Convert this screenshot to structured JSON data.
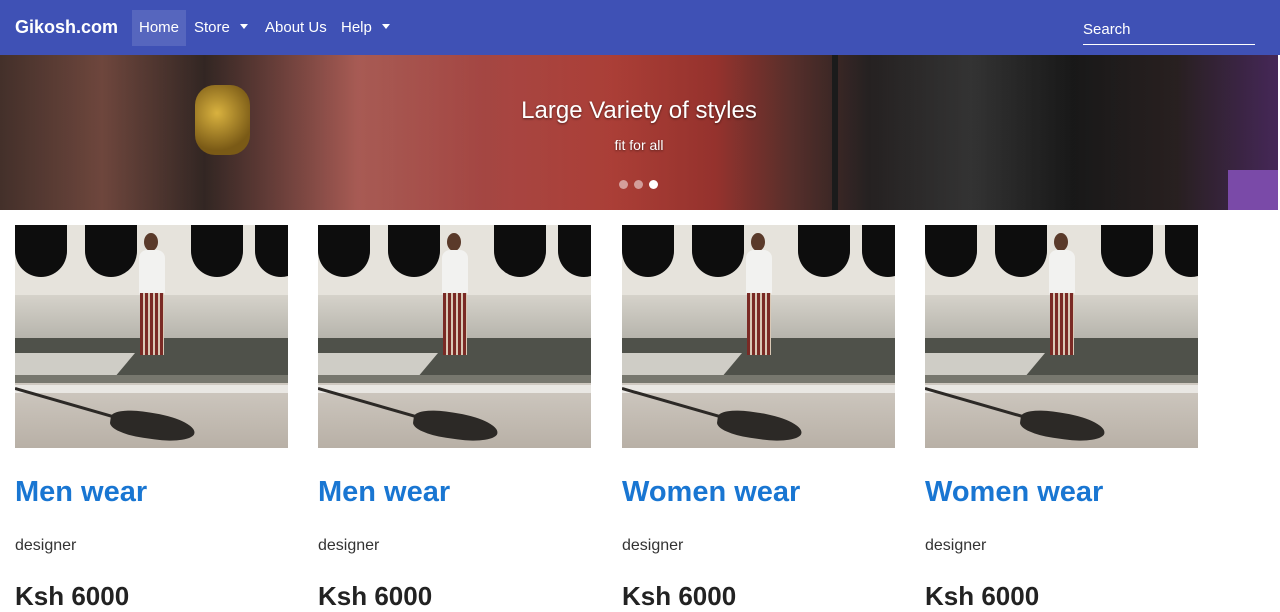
{
  "navbar": {
    "brand": "Gikosh.com",
    "items": [
      {
        "label": "Home",
        "active": true,
        "dropdown": false
      },
      {
        "label": "Store",
        "active": false,
        "dropdown": true
      },
      {
        "label": "About Us",
        "active": false,
        "dropdown": false
      },
      {
        "label": "Help",
        "active": false,
        "dropdown": true
      }
    ],
    "search_placeholder": "Search",
    "bg_color": "#3f51b5"
  },
  "carousel": {
    "title": "Large Variety of styles",
    "subtitle": "fit for all",
    "slide_count": 3,
    "active_index": 2
  },
  "products": [
    {
      "title": "Men wear",
      "description": "designer",
      "price": "Ksh 6000"
    },
    {
      "title": "Men wear",
      "description": "designer",
      "price": "Ksh 6000"
    },
    {
      "title": "Women wear",
      "description": "designer",
      "price": "Ksh 6000"
    },
    {
      "title": "Women wear",
      "description": "designer",
      "price": "Ksh 6000"
    }
  ],
  "colors": {
    "title_blue": "#1976d2",
    "price_text": "#222222"
  }
}
